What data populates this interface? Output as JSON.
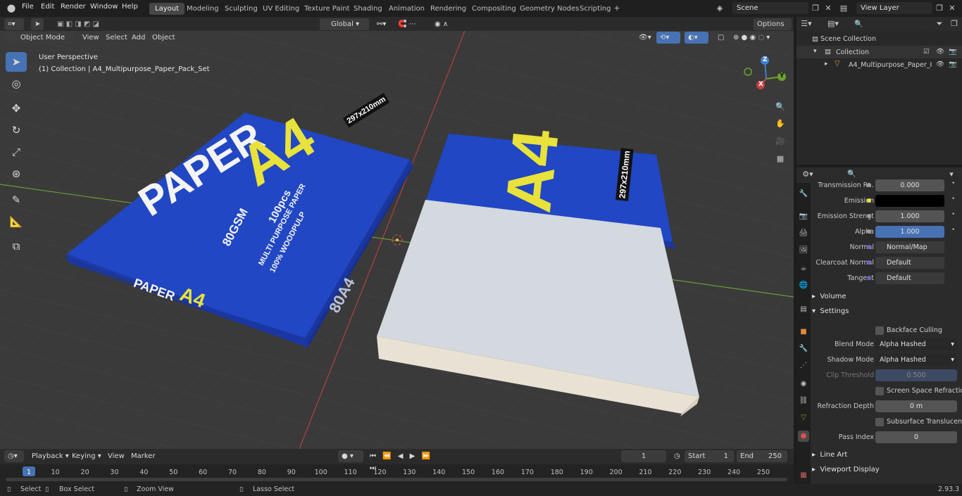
{
  "menu": [
    "File",
    "Edit",
    "Render",
    "Window",
    "Help"
  ],
  "workspaces": [
    "Layout",
    "Modeling",
    "Sculpting",
    "UV Editing",
    "Texture Paint",
    "Shading",
    "Animation",
    "Rendering",
    "Compositing",
    "Geometry Nodes",
    "Scripting"
  ],
  "active_workspace": "Layout",
  "scene_name": "Scene",
  "view_layer": "View Layer",
  "viewport_header": {
    "mode": "Object Mode",
    "menus": [
      "View",
      "Select",
      "Add",
      "Object"
    ],
    "transform_orientation": "Global",
    "options": "Options"
  },
  "viewport": {
    "perspective_label": "User Perspective",
    "collection_label": "(1) Collection | A4_Multipurpose_Paper_Pack_Set",
    "gizmo_axes": {
      "x": "X",
      "y": "Y",
      "z": "Z"
    }
  },
  "box_left": {
    "brand": "PAPER",
    "size": "A4",
    "dims": "297x210mm",
    "gsm": "80GSM",
    "count": "100pcs",
    "multi": "MULTI PURPOSE PAPER",
    "pulp": "100% WOODPULP",
    "side_code": "80A4",
    "side_brand": "PAPER",
    "side_size": "A4"
  },
  "box_right": {
    "size": "A4",
    "dims": "297x210mm"
  },
  "outliner": {
    "scene_collection": "Scene Collection",
    "collection": "Collection",
    "object": "A4_Multipurpose_Paper_I"
  },
  "properties": {
    "rows": [
      {
        "label": "Transmission R...",
        "value": "0.000",
        "style": "num"
      },
      {
        "label": "Emission",
        "value": "",
        "style": "black"
      },
      {
        "label": "Emission Strengt",
        "value": "1.000",
        "style": "num"
      },
      {
        "label": "Alpha",
        "value": "1.000",
        "style": "blue"
      },
      {
        "label": "Normal",
        "value": "Normal/Map",
        "style": "link"
      },
      {
        "label": "Clearcoat Normal",
        "value": "Default",
        "style": "link"
      },
      {
        "label": "Tangent",
        "value": "Default",
        "style": "link"
      }
    ],
    "sections": {
      "volume": "Volume",
      "settings": "Settings",
      "line_art": "Line Art",
      "viewport_display": "Viewport Display"
    },
    "settings": {
      "backface": "Backface Culling",
      "blend_label": "Blend Mode",
      "blend_value": "Alpha Hashed",
      "shadow_label": "Shadow Mode",
      "shadow_value": "Alpha Hashed",
      "clip_label": "Clip Threshold",
      "clip_value": "0.500",
      "ssr": "Screen Space Refraction",
      "refr_label": "Refraction Depth",
      "refr_value": "0 m",
      "sss": "Subsurface Translucency",
      "pass_label": "Pass Index",
      "pass_value": "0"
    }
  },
  "timeline": {
    "menus": [
      "Playback",
      "Keying",
      "View",
      "Marker"
    ],
    "current_frame": "1",
    "start_label": "Start",
    "start": "1",
    "end_label": "End",
    "end": "250",
    "ticks": [
      "1",
      "10",
      "20",
      "30",
      "40",
      "50",
      "60",
      "70",
      "80",
      "90",
      "100",
      "110",
      "120",
      "130",
      "140",
      "150",
      "160",
      "170",
      "180",
      "190",
      "200",
      "210",
      "220",
      "230",
      "240",
      "250"
    ]
  },
  "statusbar": {
    "select": "Select",
    "box_select": "Box Select",
    "zoom_view": "Zoom View",
    "lasso_select": "Lasso Select",
    "version": "2.93.3"
  },
  "colors": {
    "accent": "#4772b3",
    "box_blue": "#1e3fb8",
    "box_yellow": "#e8e23a",
    "paper": "#d4d8df"
  }
}
